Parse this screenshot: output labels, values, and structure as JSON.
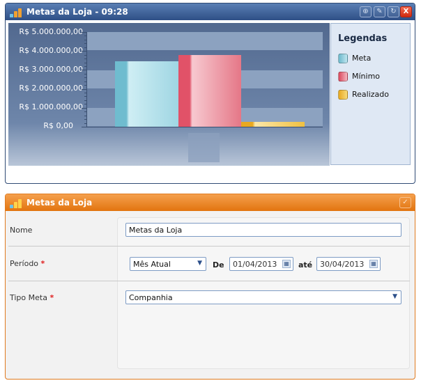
{
  "chart_widget": {
    "title": "Metas da Loja - 09:28",
    "buttons": [
      "expand",
      "edit",
      "refresh",
      "close"
    ],
    "icons": {
      "expand": "⊕",
      "edit": "✎",
      "refresh": "↻",
      "close": "X"
    },
    "colors": {
      "header": "#2e4f86",
      "meta": "#8fcfdc",
      "minimo": "#e8586d",
      "realizado": "#f0c040"
    }
  },
  "chart_data": {
    "type": "bar",
    "categories": [
      "Meta",
      "Mínimo",
      "Realizado"
    ],
    "values": [
      3450000,
      3800000,
      250000
    ],
    "yticks": [
      "R$ 5.000.000,00",
      "R$ 4.000.000,00",
      "R$ 3.000.000,00",
      "R$ 2.000.000,00",
      "R$ 1.000.000,00",
      "R$ 0,00"
    ],
    "ylim": [
      0,
      5000000
    ],
    "legend_title": "Legendas",
    "legend": [
      "Meta",
      "Mínimo",
      "Realizado"
    ],
    "legend_position": "right",
    "grid": true
  },
  "form_widget": {
    "title": "Metas da Loja",
    "check_icon": "✓",
    "fields": {
      "nome": {
        "label": "Nome",
        "value": "Metas da Loja"
      },
      "periodo": {
        "label": "Período",
        "required": "*",
        "select_value": "Mês Atual",
        "de_label": "De",
        "de_value": "01/04/2013",
        "ate_label": "até",
        "ate_value": "30/04/2013"
      },
      "tipo_meta": {
        "label": "Tipo Meta",
        "required": "*",
        "value": "Companhia"
      }
    },
    "colors": {
      "header": "#e2740f",
      "required": "#e02020"
    }
  }
}
